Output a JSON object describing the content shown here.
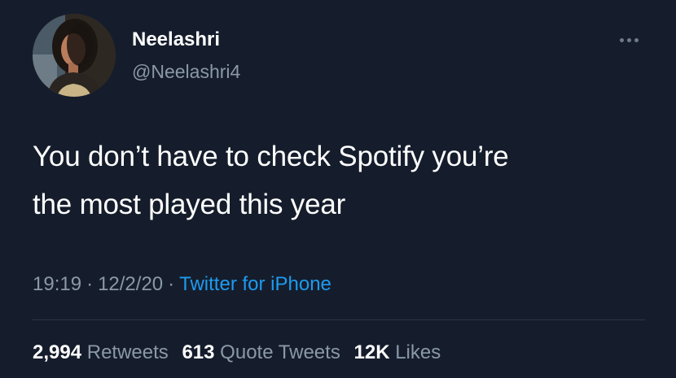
{
  "user": {
    "display_name": "Neelashri",
    "handle": "@Neelashri4"
  },
  "more_icon": "more-horizontal-icon",
  "tweet": {
    "lines": [
      "You don’t have to check Spotify you’re",
      "the most played this year"
    ]
  },
  "meta": {
    "time": "19:19",
    "separator": "·",
    "date": "12/2/20",
    "source": "Twitter for iPhone"
  },
  "stats": {
    "retweets_count": "2,994",
    "retweets_label": "Retweets",
    "quotes_count": "613",
    "quotes_label": "Quote Tweets",
    "likes_count": "12K",
    "likes_label": "Likes"
  },
  "colors": {
    "background": "#151d2c",
    "text_primary": "#ffffff",
    "text_secondary": "#8a98a8",
    "link": "#1d9bf0",
    "divider": "#2c3646"
  }
}
